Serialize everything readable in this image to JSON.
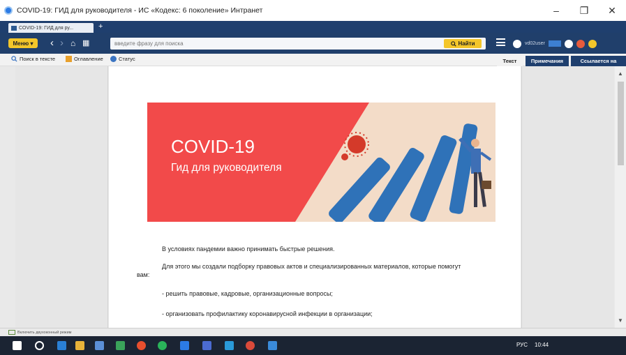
{
  "window": {
    "title": "COVID-19: ГИД для руководителя - ИС «Кодекс: 6 поколение» Интранет",
    "minimize": "–",
    "maximize": "❐",
    "close": "✕"
  },
  "browser_tab": {
    "label": "COVID-19: ГИД для ру...",
    "new_tab": "+"
  },
  "toolbar": {
    "menu_label": "Меню ▾",
    "search_placeholder": "введите фразу для поиска",
    "find_label": "Найти",
    "user_label": "vd02user"
  },
  "subbar": {
    "search_in_text": "Поиск в тексте",
    "contents": "Оглавление",
    "status": "Статус",
    "tab_text": "Текст",
    "tab_notes": "Примечания",
    "tab_refs": "Ссылается на"
  },
  "banner": {
    "title": "COVID-19",
    "subtitle": "Гид для руководителя"
  },
  "document": {
    "p1": "В условиях пандемии важно принимать быстрые решения.",
    "p2a": "Для этого мы создали подборку правовых актов и специализированных материалов, которые помогут",
    "p2b": "вам:",
    "p3": "- решить правовые, кадровые, организационные вопросы;",
    "p4": "- организовать профилактику коронавирусной инфекции в организации;"
  },
  "statusbar": {
    "left": "Включить двухоконный режим"
  },
  "taskbar": {
    "lang": "РУС",
    "time": "10:44"
  },
  "colors": {
    "brand_dark": "#1f3f6e",
    "accent_yellow": "#f3c62a",
    "banner_red": "#f24a4a",
    "banner_beige": "#f3dcc8",
    "domino_blue": "#2f72b8"
  }
}
